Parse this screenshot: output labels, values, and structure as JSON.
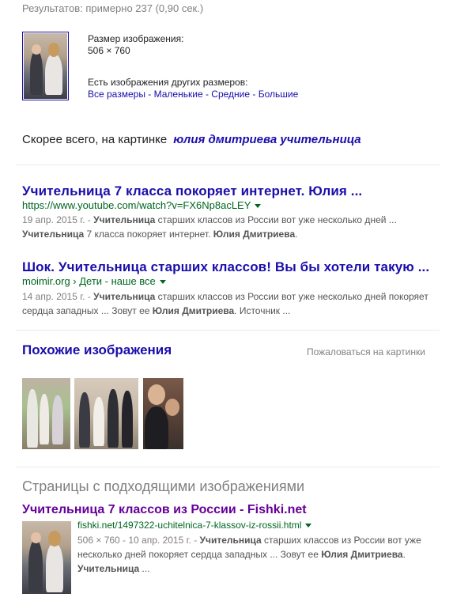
{
  "stats": "Результатов: примерно 237 (0,90 сек.)",
  "image_info": {
    "size_label": "Размер изображения:",
    "size_value": "506 × 760",
    "other_sizes_label": "Есть изображения других размеров:",
    "links": [
      "Все размеры",
      "Маленькие",
      "Средние",
      "Большие"
    ],
    "separator": " - "
  },
  "best_guess": {
    "prefix": "Скорее всего, на картинке",
    "query": "юлия дмитриева учительница"
  },
  "results": [
    {
      "title": "Учительница 7 класса покоряет интернет. Юлия ...",
      "url": "https://www.youtube.com/watch?v=FX6Np8acLEY",
      "date": "19 апр. 2015 г. - ",
      "snippet_b1": "Учительница",
      "snippet_t1": " старших классов из России вот уже несколько дней ... ",
      "snippet_b2": "Учительница",
      "snippet_t2": " 7 класса покоряет интернет. ",
      "snippet_b3": "Юлия Дмитриева",
      "snippet_t3": "."
    },
    {
      "title": "Шок. Учительница старших классов! Вы бы хотели такую ...",
      "url": "moimir.org › Дети - наше все",
      "date": "14 апр. 2015 г. - ",
      "snippet_b1": "Учительница",
      "snippet_t1": " старших классов из России вот уже несколько дней покоряет сердца западных ... Зовут ее ",
      "snippet_b2": "Юлия Дмитриева",
      "snippet_t2": ". Источник ..."
    }
  ],
  "similar": {
    "heading": "Похожие изображения",
    "report": "Пожаловаться на картинки"
  },
  "pages": {
    "heading": "Страницы с подходящими изображениями",
    "title": "Учительница 7 классов из России - Fishki.net",
    "url": "fishki.net/1497322-uchitelnica-7-klassov-iz-rossii.html",
    "meta": "506 × 760 - 10 апр. 2015 г. - ",
    "snippet_b1": "Учительница",
    "snippet_t1": " старших классов из России вот уже несколько дней покоряет сердца западных ... Зовут ее ",
    "snippet_b2": "Юлия Дмитриева",
    "snippet_t2": ". ",
    "snippet_b3": "Учительница",
    "snippet_t3": " ..."
  },
  "colors": {
    "link": "#1a0dab",
    "visited": "#660099",
    "url_green": "#006621",
    "snippet": "#545454",
    "muted": "#808080"
  }
}
